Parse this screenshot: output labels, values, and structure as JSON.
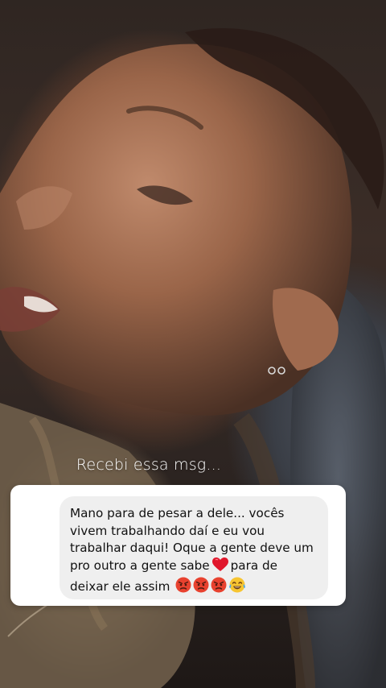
{
  "story": {
    "caption": "Recebi essa msg...",
    "message": {
      "segment_1": "Mano para de pesar a dele... vocês vivem trabalhando daí e eu vou trabalhar daqui! Oque a gente deve um pro outro a gente sabe",
      "segment_2": "para de deixar ele assim",
      "inline_icons": [
        "red-heart-icon",
        "angry-face-icon",
        "angry-face-icon",
        "angry-face-icon",
        "tears-of-joy-icon"
      ]
    }
  }
}
